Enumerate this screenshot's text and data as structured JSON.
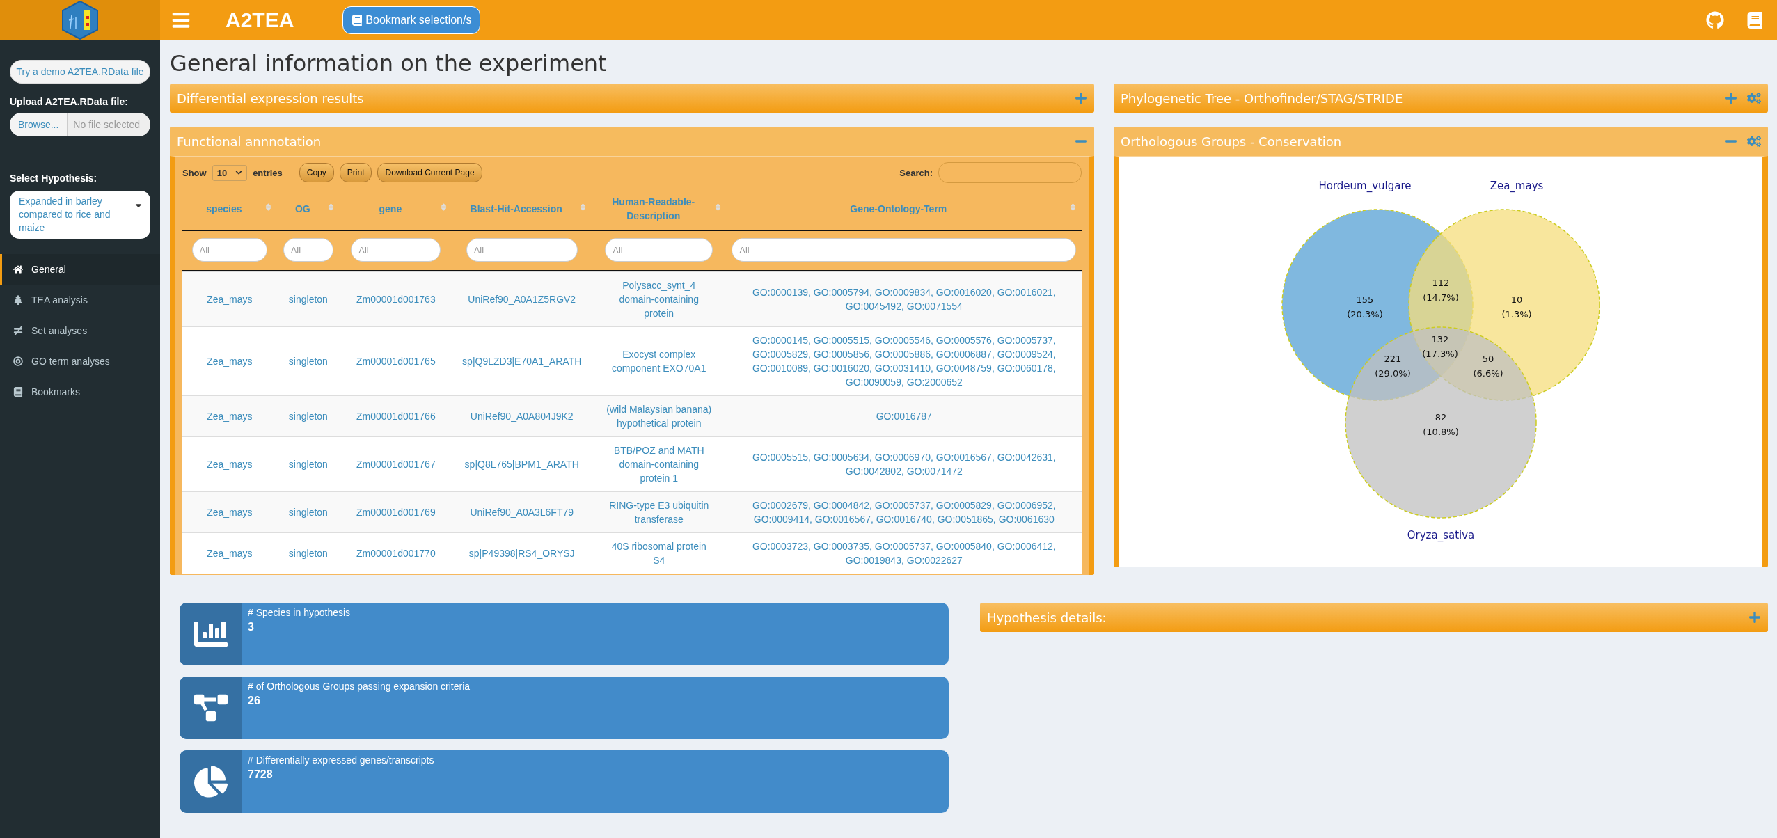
{
  "header": {
    "brand": "A2TEA",
    "bookmark_button": "Bookmark selection/s"
  },
  "sidebar": {
    "demo_button": "Try a demo A2TEA.RData file",
    "upload_label": "Upload A2TEA.RData file:",
    "browse_button": "Browse...",
    "file_placeholder": "No file selected",
    "hypothesis_label": "Select Hypothesis:",
    "hypothesis_value": "Expanded in barley compared to rice and maize",
    "items": [
      {
        "label": "General",
        "kind": "home",
        "selected": true
      },
      {
        "label": "TEA analysis",
        "kind": "tree",
        "selected": false
      },
      {
        "label": "Set analyses",
        "kind": "notequal",
        "selected": false
      },
      {
        "label": "GO term analyses",
        "kind": "target",
        "selected": false
      },
      {
        "label": "Bookmarks",
        "kind": "book",
        "selected": false
      }
    ]
  },
  "page_title": "General information on the experiment",
  "panels": {
    "differential": {
      "title": "Differential expression results",
      "expanded": false
    },
    "functional": {
      "title": "Functional annnotation",
      "expanded": true
    },
    "phylo": {
      "title": "Phylogenetic Tree - Orthofinder/STAG/STRIDE",
      "expanded": false
    },
    "ortho": {
      "title": "Orthologous Groups - Conservation",
      "expanded": true
    },
    "hypothesis": {
      "title": "Hypothesis details:",
      "expanded": false
    }
  },
  "table": {
    "show_label": "Show",
    "page_size": "10",
    "entries_label": "entries",
    "buttons": [
      "Copy",
      "Print",
      "Download Current Page"
    ],
    "search_label": "Search:",
    "columns": [
      "species",
      "OG",
      "gene",
      "Blast-Hit-Accession",
      "Human-Readable-Description",
      "Gene-Ontology-Term"
    ],
    "filter_placeholders": [
      "All",
      "All",
      "All",
      "All",
      "All",
      "All"
    ],
    "rows": [
      [
        "Zea_mays",
        "singleton",
        "Zm00001d001763",
        "UniRef90_A0A1Z5RGV2",
        "Polysacc_synt_4 domain-containing protein",
        "GO:0000139, GO:0005794, GO:0009834, GO:0016020, GO:0016021, GO:0045492, GO:0071554"
      ],
      [
        "Zea_mays",
        "singleton",
        "Zm00001d001765",
        "sp|Q9LZD3|E70A1_ARATH",
        "Exocyst complex component EXO70A1",
        "GO:0000145, GO:0005515, GO:0005546, GO:0005576, GO:0005737, GO:0005829, GO:0005856, GO:0005886, GO:0006887, GO:0009524, GO:0010089, GO:0016020, GO:0031410, GO:0048759, GO:0060178, GO:0090059, GO:2000652"
      ],
      [
        "Zea_mays",
        "singleton",
        "Zm00001d001766",
        "UniRef90_A0A804J9K2",
        "(wild Malaysian banana) hypothetical protein",
        "GO:0016787"
      ],
      [
        "Zea_mays",
        "singleton",
        "Zm00001d001767",
        "sp|Q8L765|BPM1_ARATH",
        "BTB/POZ and MATH domain-containing protein 1",
        "GO:0005515, GO:0005634, GO:0006970, GO:0016567, GO:0042631, GO:0042802, GO:0071472"
      ],
      [
        "Zea_mays",
        "singleton",
        "Zm00001d001769",
        "UniRef90_A0A3L6FT79",
        "RING-type E3 ubiquitin transferase",
        "GO:0002679, GO:0004842, GO:0005737, GO:0005829, GO:0006952, GO:0009414, GO:0016567, GO:0016740, GO:0051865, GO:0061630"
      ],
      [
        "Zea_mays",
        "singleton",
        "Zm00001d001770",
        "sp|P49398|RS4_ORYSJ",
        "40S ribosomal protein S4",
        "GO:0003723, GO:0003735, GO:0005737, GO:0005840, GO:0006412, GO:0019843, GO:0022627"
      ]
    ]
  },
  "venn": {
    "sets": [
      {
        "name": "Hordeum_vulgare",
        "color": "#80b8df"
      },
      {
        "name": "Zea_mays",
        "color": "#f6de7c"
      },
      {
        "name": "Oryza_sativa",
        "color": "#c0c0c0"
      }
    ],
    "regions": [
      {
        "count": "155",
        "percent": "(20.3%)"
      },
      {
        "count": "112",
        "percent": "(14.7%)"
      },
      {
        "count": "10",
        "percent": "(1.3%)"
      },
      {
        "count": "132",
        "percent": "(17.3%)"
      },
      {
        "count": "221",
        "percent": "(29.0%)"
      },
      {
        "count": "50",
        "percent": "(6.6%)"
      },
      {
        "count": "82",
        "percent": "(10.8%)"
      }
    ]
  },
  "info_boxes": [
    {
      "kind": "chart",
      "label": "# Species in hypothesis",
      "value": "3"
    },
    {
      "kind": "diagram",
      "label": "# of Orthologous Groups passing expansion criteria",
      "value": "26"
    },
    {
      "kind": "pie",
      "label": "# Differentially expressed genes/transcripts",
      "value": "7728"
    }
  ]
}
